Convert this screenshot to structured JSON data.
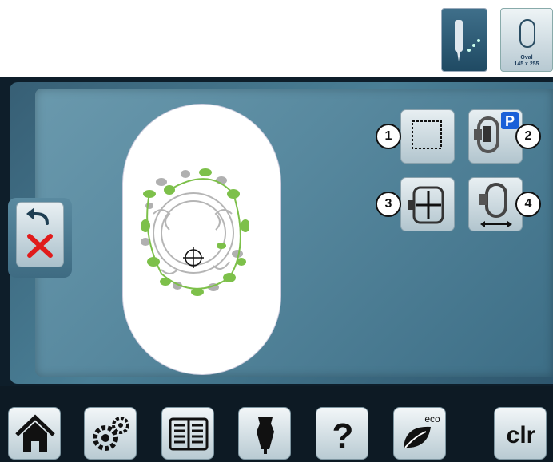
{
  "top_icons": {
    "hoop_label_line1": "Oval",
    "hoop_label_line2": "145 x 255"
  },
  "callouts": [
    "1",
    "2",
    "3",
    "4"
  ],
  "buttons": {
    "clr_label": "clr",
    "eco_label": "eco",
    "help_label": "?"
  },
  "colors": {
    "panel": "#4a7f96",
    "design_green": "#7dc04a",
    "design_gray": "#b5b5b5",
    "undo_x": "#e01b1b"
  }
}
